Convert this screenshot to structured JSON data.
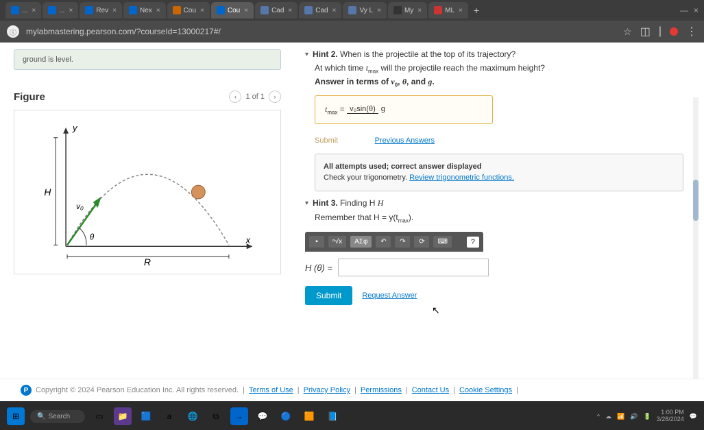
{
  "tabs": [
    {
      "label": "...",
      "icon": "#0066cc"
    },
    {
      "label": "...",
      "icon": "#0066cc"
    },
    {
      "label": "Rev",
      "icon": "#0066cc"
    },
    {
      "label": "Nex",
      "icon": "#0066cc"
    },
    {
      "label": "Cou",
      "icon": "#cc6600"
    },
    {
      "label": "Cou",
      "icon": "#0066cc",
      "active": true
    },
    {
      "label": "Cad",
      "icon": "#5577aa"
    },
    {
      "label": "Cad",
      "icon": "#5577aa"
    },
    {
      "label": "Vy L",
      "icon": "#5577aa"
    },
    {
      "label": "My",
      "icon": "#333"
    },
    {
      "label": "ML",
      "icon": "#cc3333"
    }
  ],
  "url": "mylabmastering.pearson.com/?courseId=13000217#/",
  "left": {
    "info_text": "ground is level.",
    "figure_title": "Figure",
    "figure_nav": "1 of 1",
    "labels": {
      "y": "y",
      "x": "x",
      "H": "H",
      "R": "R",
      "v0": "v₀",
      "theta": "θ"
    }
  },
  "hint2": {
    "title": "Hint 2.",
    "question": "When is the projectile at the top of its trajectory?",
    "line2_a": "At which time ",
    "line2_b": " will the projectile reach the maximum height?",
    "line3": "Answer in terms of v₀, θ, and g.",
    "formula_lhs": "t",
    "formula_sub": "max",
    "formula_num": "v₀sin(θ)",
    "formula_den": "g",
    "submit_label": "Submit",
    "prev_answers": "Previous Answers",
    "feedback_bold": "All attempts used; correct answer displayed",
    "feedback_text": "Check your trigonometry. ",
    "review_link": "Review trigonometric functions."
  },
  "hint3": {
    "title": "Hint 3.",
    "subtitle": "Finding H",
    "remember": "Remember that H = y(t",
    "remember_sub": "max",
    "remember_end": ").",
    "toolbar": {
      "sqrt": "ⁿ√x",
      "greek": "ΑΣφ",
      "undo": "↶",
      "redo": "↷",
      "reset": "⟳",
      "kb": "⌨",
      "help": "?"
    },
    "answer_label": "H (θ) =",
    "submit": "Submit",
    "request": "Request Answer"
  },
  "footer": {
    "copyright": "Copyright © 2024  Pearson Education Inc. All rights reserved.",
    "links": [
      "Terms of Use",
      "Privacy Policy",
      "Permissions",
      "Contact Us",
      "Cookie Settings"
    ]
  },
  "taskbar": {
    "search": "Search",
    "time": "1:00 PM",
    "date": "3/28/2024"
  },
  "chart_data": {
    "type": "trajectory",
    "description": "Parabolic projectile path launched at angle θ with initial velocity v₀, reaching max height H, horizontal range R",
    "axes": {
      "x": "x",
      "y": "y"
    },
    "params": [
      "H",
      "R",
      "v₀",
      "θ"
    ]
  }
}
